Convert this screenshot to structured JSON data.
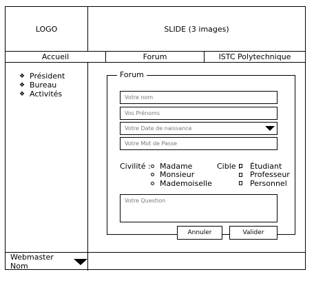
{
  "header": {
    "logo": "LOGO",
    "slide": "SLIDE (3 images)"
  },
  "nav": {
    "items": [
      "Accueil",
      "Forum",
      "ISTC Polytechnique"
    ]
  },
  "sidebar": {
    "bullet": "❖",
    "items": [
      "Président",
      "Bureau",
      "Activités"
    ]
  },
  "forum": {
    "legend": "Forum",
    "placeholders": {
      "name": "Votre nom",
      "firstnames": "Vos Prénoms",
      "birthdate": "Votre Date de naissance",
      "password": "Votre Mot de Passe",
      "question": "Votre Question"
    },
    "civilite": {
      "label": "Civilité :",
      "options": [
        "Madame",
        "Monsieur",
        "Mademoiselle"
      ]
    },
    "cible": {
      "label": "Cible :",
      "options": [
        "Étudiant",
        "Professeur",
        "Personnel"
      ]
    },
    "buttons": {
      "cancel": "Annuler",
      "submit": "Valider"
    }
  },
  "footer": {
    "webmaster": "Webmaster Nom"
  }
}
